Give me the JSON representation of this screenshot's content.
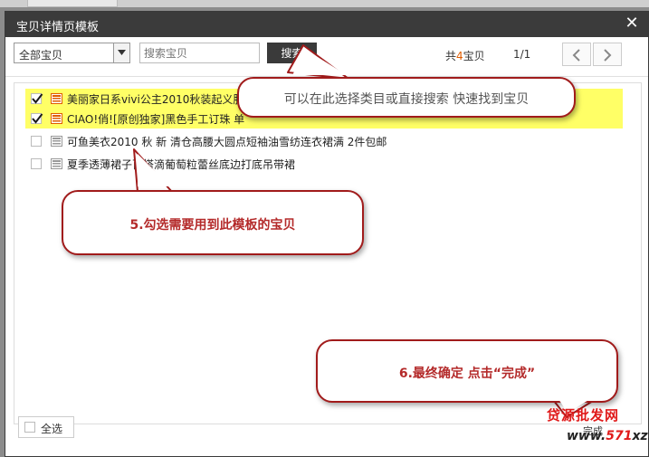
{
  "dialog": {
    "title": "宝贝详情页模板",
    "close_icon": "close-icon"
  },
  "toolbar": {
    "category_select": {
      "value": "全部宝贝"
    },
    "search": {
      "placeholder": "搜索宝贝",
      "button_label": "搜索"
    },
    "count_prefix": "共",
    "count_value": "4",
    "count_suffix": "宝贝",
    "page_indicator": "1/1"
  },
  "items": [
    {
      "title": "美丽家日系vivi公主2010秋装起义服饰",
      "checked": true
    },
    {
      "title": "CIAO!俏![原创独家]黑色手工订珠 单",
      "checked": true
    },
    {
      "title": "可鱼美衣2010 秋 新 清仓高腰大圆点短袖油雪纺连衣裙满 2件包邮",
      "checked": false
    },
    {
      "title": "夏季透薄裙子百搭滴葡萄粒蕾丝底边打底吊带裙",
      "checked": false
    }
  ],
  "footer": {
    "select_all_label": "全选"
  },
  "callouts": {
    "search_tip": "可以在此选择类目或直接搜索 快速找到宝贝",
    "step5": "5.勾选需要用到此模板的宝贝",
    "step6": "6.最终确定 点击“完成”"
  },
  "done_button": {
    "label": "完成"
  },
  "watermark": {
    "line1": "贷源批发网",
    "line2_a": "www.",
    "line2_b": "571",
    "line2_c": "xz.cn"
  },
  "colors": {
    "titlebar": "#3b3b3b",
    "highlight": "#ffff66",
    "callout_border": "#a11b1b",
    "callout_text": "#b42a2a",
    "count_accent": "#e05c00"
  }
}
